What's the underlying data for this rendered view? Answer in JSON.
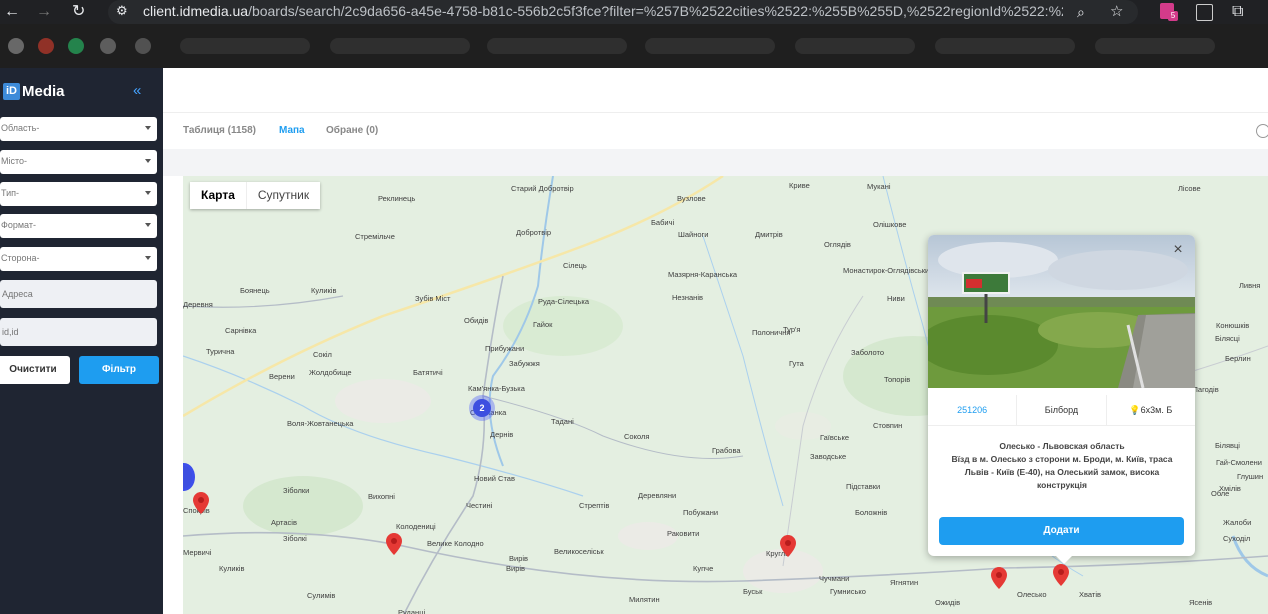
{
  "browser": {
    "url_host": "client.idmedia.ua",
    "url_path": "/boards/search/2c9da656-a45e-4758-b81c-556b2c5f3fce?filter=%257B%2522cities%2522:%255B%255D,%2522regionId%2522:%2...",
    "ext_badge": "5"
  },
  "sidebar": {
    "logo_mark": "iD",
    "logo_text": "Media",
    "collapse_icon": "«",
    "filters": [
      "Область-",
      "Місто-",
      "Тип-",
      "Формат-",
      "Сторона-"
    ],
    "address_placeholder": "Адреса",
    "id_placeholder": "id,id",
    "clear_label": "Очистити",
    "filter_label": "Фільтр"
  },
  "tabs": [
    {
      "label": "Таблиця (1158)",
      "active": false
    },
    {
      "label": "Мапа",
      "active": true
    },
    {
      "label": "Обране (0)",
      "active": false
    }
  ],
  "map": {
    "type_map": "Карта",
    "type_satellite": "Супутник",
    "cluster_count": "2",
    "places": [
      "Лісове",
      "Мукані",
      "Криве",
      "Старий Добротвір",
      "Реклинець",
      "Вузлове",
      "Бабичі",
      "Шайноги",
      "Дмитрів",
      "Оглядів",
      "Олішкове",
      "Стремільче",
      "Добротвір",
      "Сілець",
      "Мазярня-Каранська",
      "Монастирок-Оглядівський",
      "Деревня",
      "Боянець",
      "Куликів",
      "Зубів Міст",
      "Руда-Сілецька",
      "Незнанів",
      "Ниви",
      "Сарнівка",
      "Обидів",
      "Гайок",
      "Полоничня",
      "Тур'я",
      "Турична",
      "Сокіл",
      "Прибужани",
      "Забужжя",
      "Гута",
      "Заболото",
      "Верени",
      "Жолдобище",
      "Батятичі",
      "Кам'янка-Бузька",
      "Топорів",
      "Воля-Жовтанецька",
      "Сапіжанка",
      "Тадані",
      "Дернів",
      "Соколя",
      "Гаївське",
      "Стовпин",
      "Грабова",
      "Заводське",
      "Новий Став",
      "Зіболки",
      "Вихопні",
      "Честині",
      "Стрептів",
      "Деревляни",
      "Підставки",
      "Спокрів",
      "Артасів",
      "Колодениці",
      "Велике Колодно",
      "Побужани",
      "Боложнів",
      "Мервичі",
      "Раковити",
      "Зіболкі",
      "Вирів",
      "Великоселіськ",
      "Куликів",
      "Сулимів",
      "Хватів",
      "Олесько",
      "Ожидів",
      "Ясенів",
      "Буськ",
      "Чучмани",
      "Гумнисько",
      "Милятин",
      "Купче",
      "Руданці",
      "Ягнятин",
      "Кругла",
      "Конюшків",
      "Берлин",
      "Лагодів",
      "Білявці",
      "Глушин",
      "Суходіл",
      "Жалоби",
      "Ливня",
      "Білясці",
      "Гай-Смолени",
      "Хмілів",
      "Обле",
      "Вирів"
    ],
    "popup": {
      "close_icon": "×",
      "code": "251206",
      "type": "Білборд",
      "size": "6x3м. Б",
      "title": "Олесько - Львовская область",
      "description": "Вїзд в м. Олесько з сторони м. Броди, м. Київ, траса Львів - Київ (Е-40), на Олеський замок, висока конструкція",
      "add_label": "Додати"
    }
  }
}
